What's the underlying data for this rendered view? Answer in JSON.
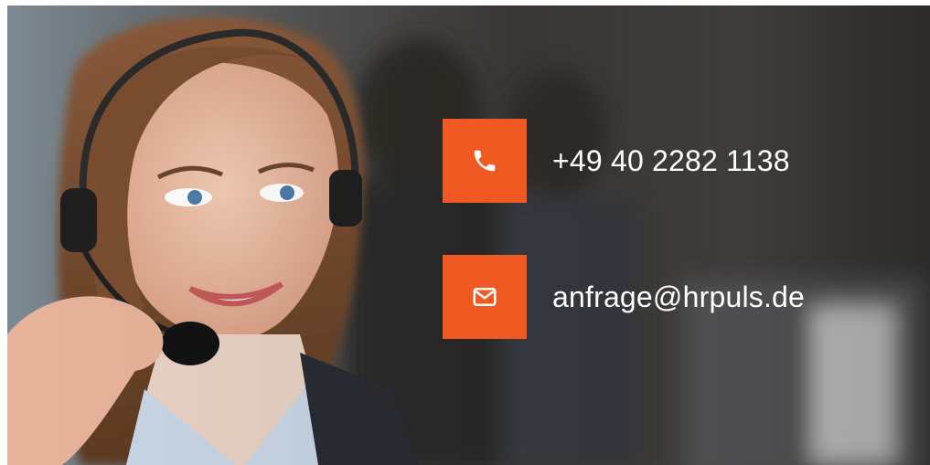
{
  "hero": {
    "image_alt": "Call center agent with headset"
  },
  "contact": {
    "phone": {
      "icon": "phone-icon",
      "text": "+49 40 2282 1138"
    },
    "email": {
      "icon": "mail-icon",
      "text": "anfrage@hrpuls.de"
    }
  },
  "colors": {
    "accent": "#f05a22",
    "text": "#ffffff"
  }
}
